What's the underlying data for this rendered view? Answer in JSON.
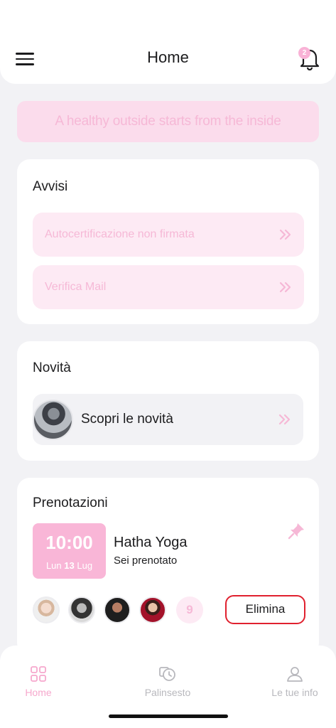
{
  "header": {
    "title": "Home",
    "notification_count": "2"
  },
  "banner": {
    "text": "A healthy outside starts from the inside"
  },
  "alerts": {
    "title": "Avvisi",
    "items": [
      {
        "label": "Autocertificazione non firmata"
      },
      {
        "label": "Verifica Mail"
      }
    ]
  },
  "news": {
    "title": "Novità",
    "item_label": "Scopri le novità"
  },
  "bookings": {
    "title": "Prenotazioni",
    "time": "10:00",
    "day": "Lun",
    "date_num": "13",
    "month": "Lug",
    "class_name": "Hatha Yoga",
    "status": "Sei prenotato",
    "participants_count": "9",
    "delete_label": "Elimina"
  },
  "tabbar": {
    "tabs": [
      {
        "label": "Home",
        "icon": "grid-icon",
        "active": true
      },
      {
        "label": "Palinsesto",
        "icon": "schedule-icon",
        "active": false
      },
      {
        "label": "Le tue info",
        "icon": "user-icon",
        "active": false
      }
    ]
  },
  "colors": {
    "accent": "#f6b8d6",
    "danger": "#e0202e"
  }
}
